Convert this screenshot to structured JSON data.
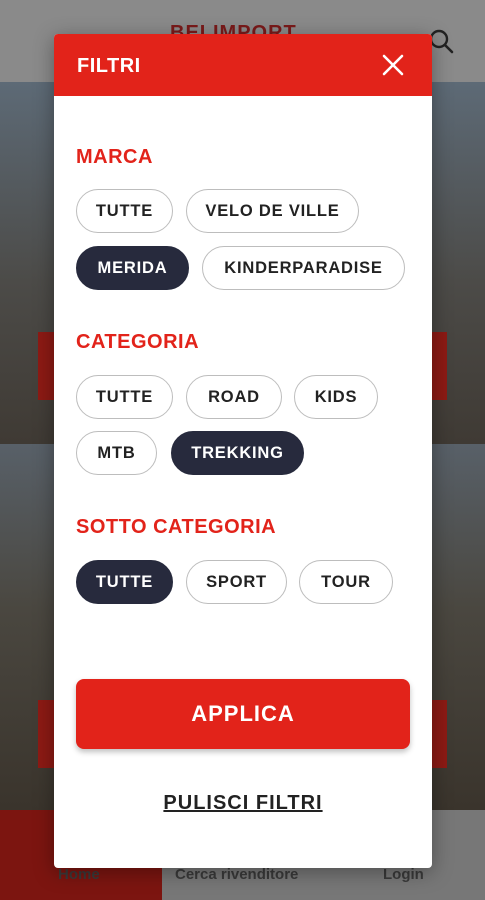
{
  "background": {
    "logo": "BELIMPORT",
    "nav": {
      "home": "Home",
      "dealer": "Cerca rivenditore",
      "login": "Login"
    }
  },
  "modal": {
    "title": "FILTRI",
    "sections": [
      {
        "title": "MARCA",
        "chips": [
          {
            "label": "TUTTE",
            "selected": false
          },
          {
            "label": "VELO DE VILLE",
            "selected": false
          },
          {
            "label": "MERIDA",
            "selected": true
          },
          {
            "label": "KINDERPARADISE",
            "selected": false
          }
        ]
      },
      {
        "title": "CATEGORIA",
        "chips": [
          {
            "label": "TUTTE",
            "selected": false
          },
          {
            "label": "ROAD",
            "selected": false
          },
          {
            "label": "KIDS",
            "selected": false
          },
          {
            "label": "MTB",
            "selected": false
          },
          {
            "label": "TREKKING",
            "selected": true
          }
        ]
      },
      {
        "title": "SOTTO CATEGORIA",
        "chips": [
          {
            "label": "TUTTE",
            "selected": true
          },
          {
            "label": "SPORT",
            "selected": false
          },
          {
            "label": "TOUR",
            "selected": false
          }
        ]
      }
    ],
    "apply_label": "APPLICA",
    "clear_label": "PULISCI FILTRI"
  },
  "colors": {
    "accent": "#e2231a",
    "selected_chip": "#272a3d"
  }
}
